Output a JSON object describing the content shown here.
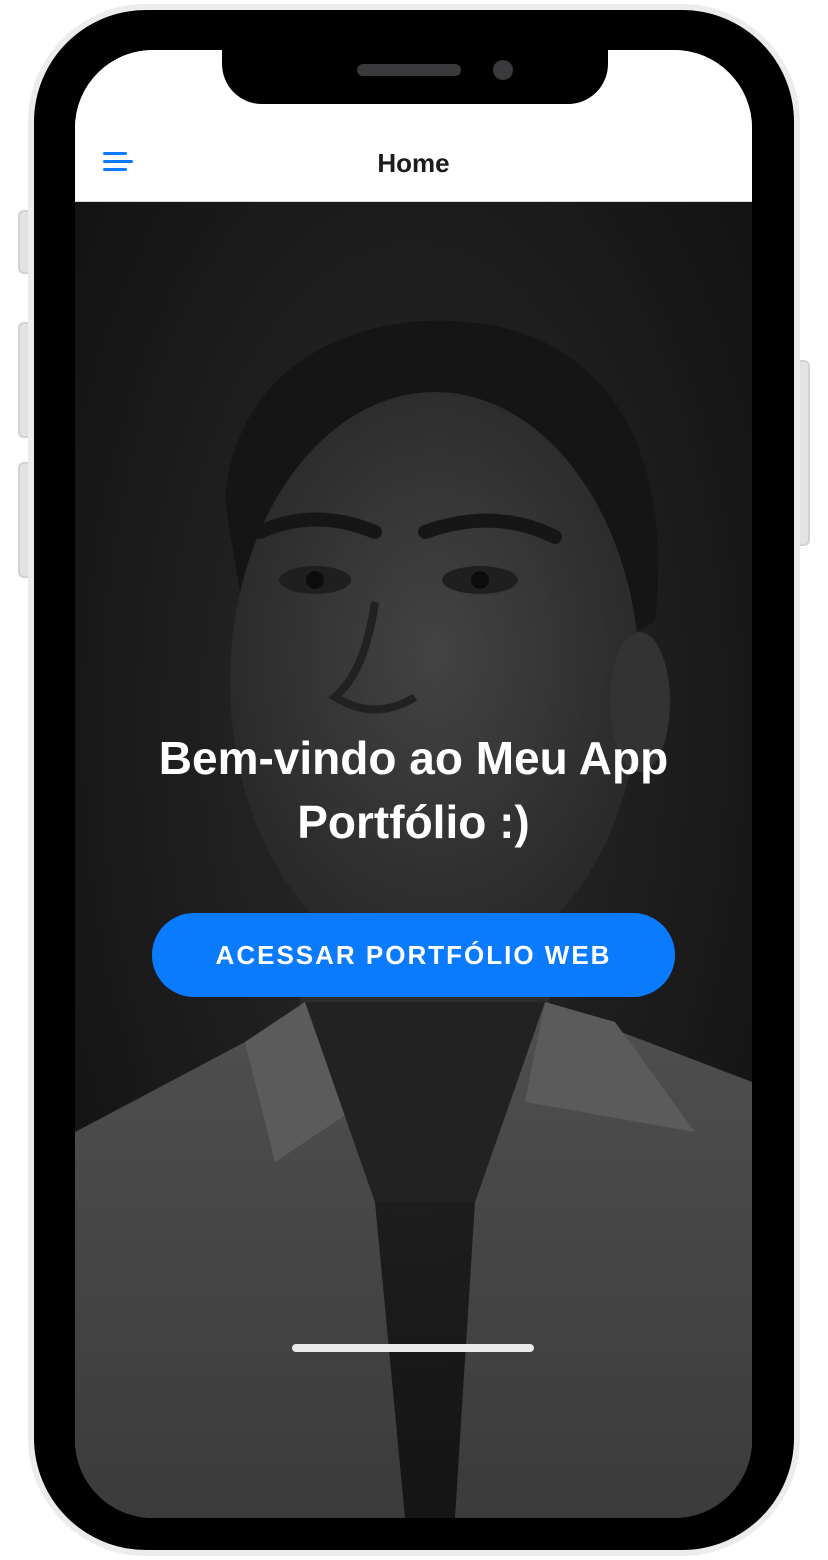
{
  "header": {
    "title": "Home",
    "menu_icon": "hamburger-menu-icon",
    "accent_color": "#0a7bff"
  },
  "hero": {
    "welcome_text": "Bem-vindo ao Meu App Portfólio :)",
    "cta_label": "ACESSAR PORTFÓLIO WEB",
    "cta_color": "#0a7bff",
    "background": "black-and-white portrait photo"
  }
}
